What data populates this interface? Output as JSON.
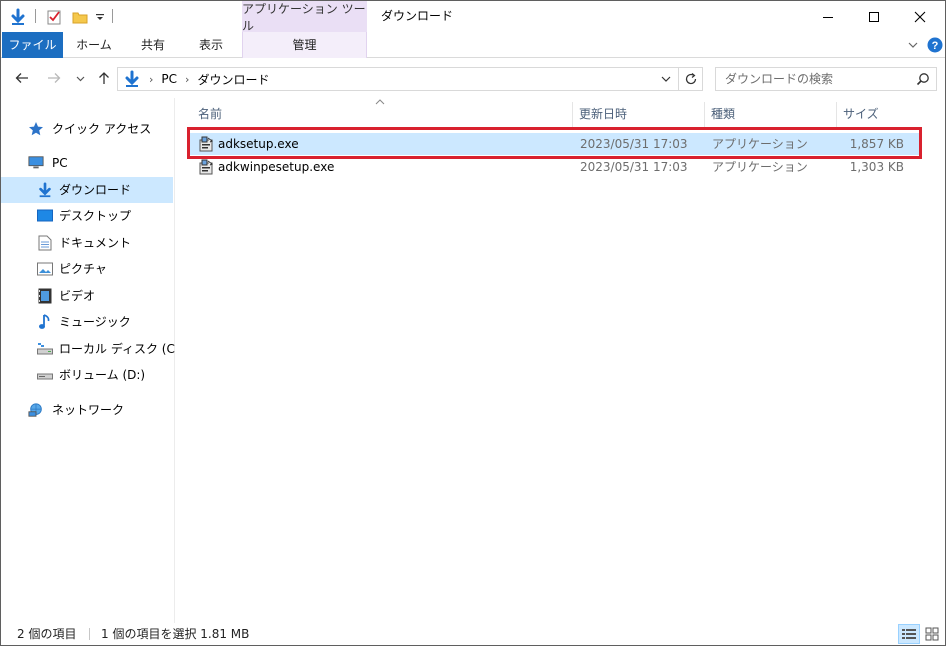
{
  "window": {
    "title": "ダウンロード",
    "context_group": "アプリケーション ツール"
  },
  "ribbon": {
    "tabs": [
      {
        "label": "ファイル"
      },
      {
        "label": "ホーム"
      },
      {
        "label": "共有"
      },
      {
        "label": "表示"
      },
      {
        "label": "管理"
      }
    ]
  },
  "address": {
    "breadcrumbs": [
      "PC",
      "ダウンロード"
    ]
  },
  "search": {
    "placeholder": "ダウンロードの検索"
  },
  "nav": {
    "items": [
      {
        "label": "クイック アクセス",
        "icon": "star-icon"
      },
      {
        "label": "PC",
        "icon": "computer-icon"
      },
      {
        "label": "ダウンロード",
        "icon": "download-arrow-icon"
      },
      {
        "label": "デスクトップ",
        "icon": "desktop-icon"
      },
      {
        "label": "ドキュメント",
        "icon": "document-icon"
      },
      {
        "label": "ピクチャ",
        "icon": "picture-icon"
      },
      {
        "label": "ビデオ",
        "icon": "video-icon"
      },
      {
        "label": "ミュージック",
        "icon": "music-note-icon"
      },
      {
        "label": "ローカル ディスク (C:)",
        "icon": "local-disk-icon"
      },
      {
        "label": "ボリューム (D:)",
        "icon": "drive-icon"
      },
      {
        "label": "ネットワーク",
        "icon": "network-icon"
      }
    ]
  },
  "file_list": {
    "columns": [
      "名前",
      "更新日時",
      "種類",
      "サイズ"
    ],
    "rows": [
      {
        "name": "adksetup.exe",
        "modified": "2023/05/31 17:03",
        "type": "アプリケーション",
        "size": "1,857 KB",
        "selected": true
      },
      {
        "name": "adkwinpesetup.exe",
        "modified": "2023/05/31 17:03",
        "type": "アプリケーション",
        "size": "1,303 KB",
        "selected": false
      }
    ]
  },
  "status": {
    "item_count": "2 個の項目",
    "selection": "1 個の項目を選択  1.81 MB"
  },
  "colors": {
    "accent": "#1c6ec1",
    "selection": "#cce8ff",
    "context_tab": "#eadff5",
    "highlight_box": "#d9212e"
  }
}
